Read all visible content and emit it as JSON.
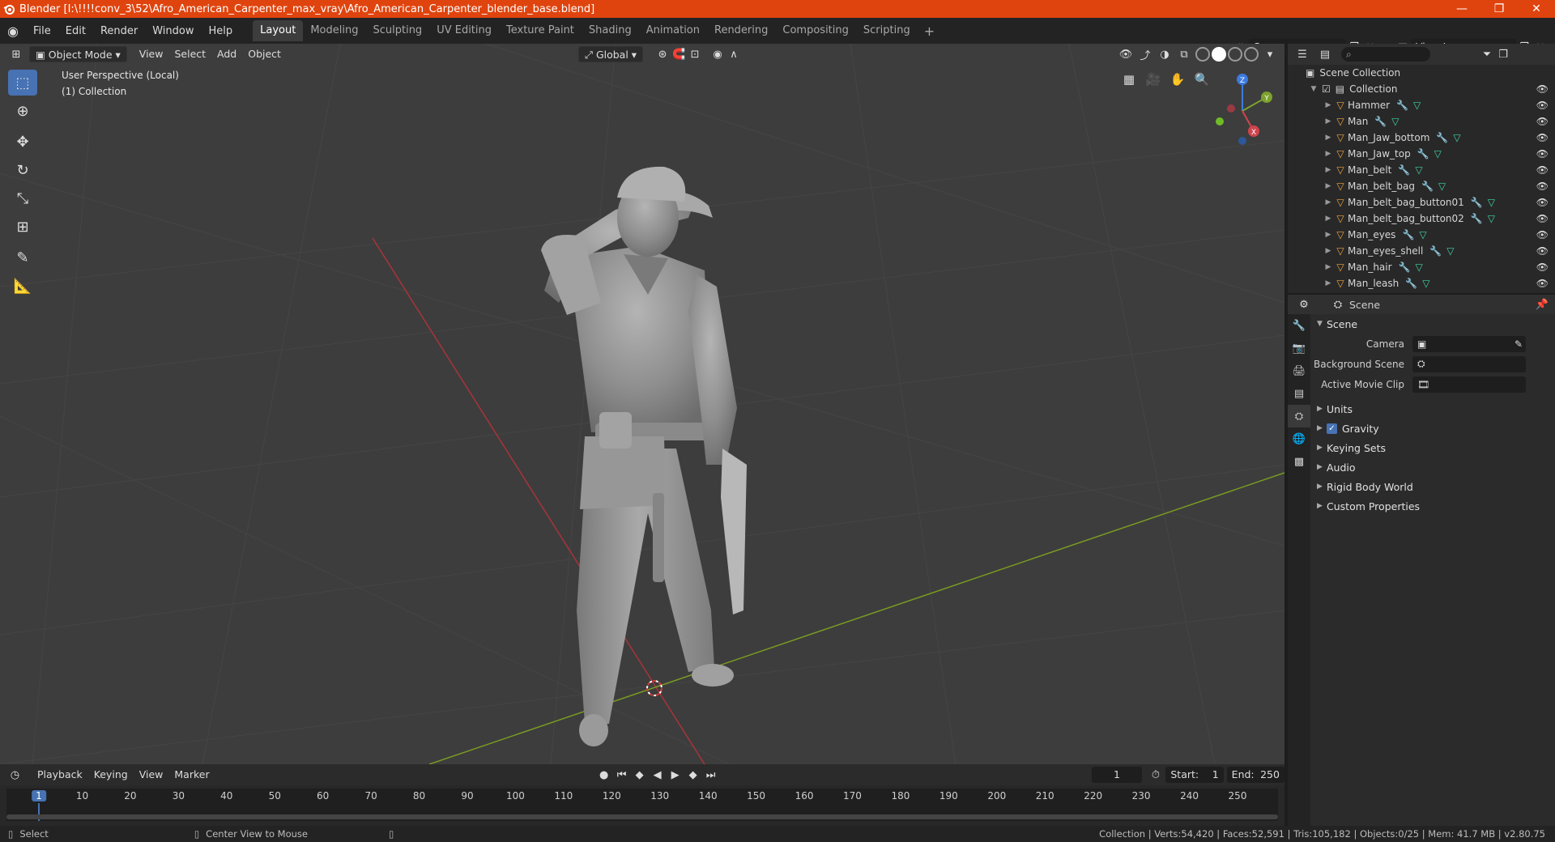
{
  "window": {
    "title": "Blender [I:\\!!!!conv_3\\52\\Afro_American_Carpenter_max_vray\\Afro_American_Carpenter_blender_base.blend]",
    "controls": [
      "—",
      "❐",
      "✕"
    ]
  },
  "menu": [
    "File",
    "Edit",
    "Render",
    "Window",
    "Help"
  ],
  "workspaces": [
    "Layout",
    "Modeling",
    "Sculpting",
    "UV Editing",
    "Texture Paint",
    "Shading",
    "Animation",
    "Rendering",
    "Compositing",
    "Scripting"
  ],
  "active_workspace": "Layout",
  "scene_field": "Scene",
  "view_layer_field": "View Layer",
  "viewport": {
    "mode": "Object Mode",
    "menus": [
      "View",
      "Select",
      "Add",
      "Object"
    ],
    "transform_orientation": "Global",
    "info_line1": "User Perspective (Local)",
    "info_line2": "(1) Collection"
  },
  "gizmo": {
    "x": "X",
    "y": "Y",
    "z": "Z"
  },
  "timeline": {
    "menus": [
      "Playback",
      "Keying",
      "View",
      "Marker"
    ],
    "current_frame": "1",
    "start_label": "Start:",
    "start": "1",
    "end_label": "End:",
    "end": "250",
    "ticks": [
      "1",
      "10",
      "20",
      "30",
      "40",
      "50",
      "60",
      "70",
      "80",
      "90",
      "100",
      "110",
      "120",
      "130",
      "140",
      "150",
      "160",
      "170",
      "180",
      "190",
      "200",
      "210",
      "220",
      "230",
      "240",
      "250"
    ]
  },
  "status": {
    "select": "Select",
    "center": "Center View to Mouse",
    "stats": "Collection | Verts:54,420 | Faces:52,591 | Tris:105,182 | Objects:0/25 | Mem: 41.7 MB | v2.80.75"
  },
  "outliner": {
    "root": "Scene Collection",
    "collection": "Collection",
    "objects": [
      "Hammer",
      "Man",
      "Man_Jaw_bottom",
      "Man_Jaw_top",
      "Man_belt",
      "Man_belt_bag",
      "Man_belt_bag_button01",
      "Man_belt_bag_button02",
      "Man_eyes",
      "Man_eyes_shell",
      "Man_hair",
      "Man_leash"
    ]
  },
  "properties": {
    "context": "Scene",
    "panel": "Scene",
    "camera_label": "Camera",
    "background_scene_label": "Background Scene",
    "active_movie_clip_label": "Active Movie Clip",
    "subpanels": [
      "Units",
      "Gravity",
      "Keying Sets",
      "Audio",
      "Rigid Body World",
      "Custom Properties"
    ]
  }
}
